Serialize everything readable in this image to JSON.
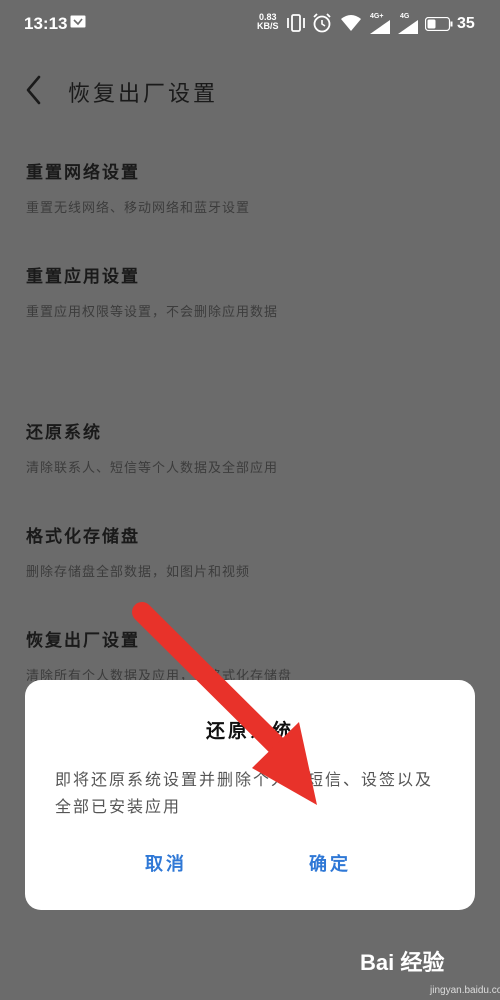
{
  "status_bar": {
    "time": "13:13",
    "net_speed_value": "0.83",
    "net_speed_unit": "KB/S",
    "signal1_label": "4G+",
    "signal2_label": "4G",
    "battery": "35",
    "icons": [
      "message-icon",
      "vibrate-icon",
      "alarm-icon",
      "wifi-icon",
      "signal-icon",
      "battery-icon"
    ]
  },
  "header": {
    "title": "恢复出厂设置",
    "back_icon": "chevron-left-icon"
  },
  "options": [
    {
      "title": "重置网络设置",
      "desc": "重置无线网络、移动网络和蓝牙设置"
    },
    {
      "title": "重置应用设置",
      "desc": "重置应用权限等设置，不会删除应用数据"
    },
    {
      "title": "还原系统",
      "desc": "清除联系人、短信等个人数据及全部应用"
    },
    {
      "title": "格式化存储盘",
      "desc": "删除存储盘全部数据，如图片和视频"
    },
    {
      "title": "恢复出厂设置",
      "desc": "清除所有个人数据及应用，并格式化存储盘"
    }
  ],
  "dialog": {
    "title": "还原系统",
    "message": "即将还原系统设置并删除个人、短信、设签以及全部已安装应用",
    "cancel_label": "取消",
    "confirm_label": "确定"
  },
  "annotation": {
    "arrow_color": "#e8322a"
  },
  "watermark": {
    "brand": "Bai 经验",
    "url": "jingyan.baidu.com"
  },
  "colors": {
    "dim_background": "#6b6b6b",
    "dialog_button": "#2f78d6"
  }
}
